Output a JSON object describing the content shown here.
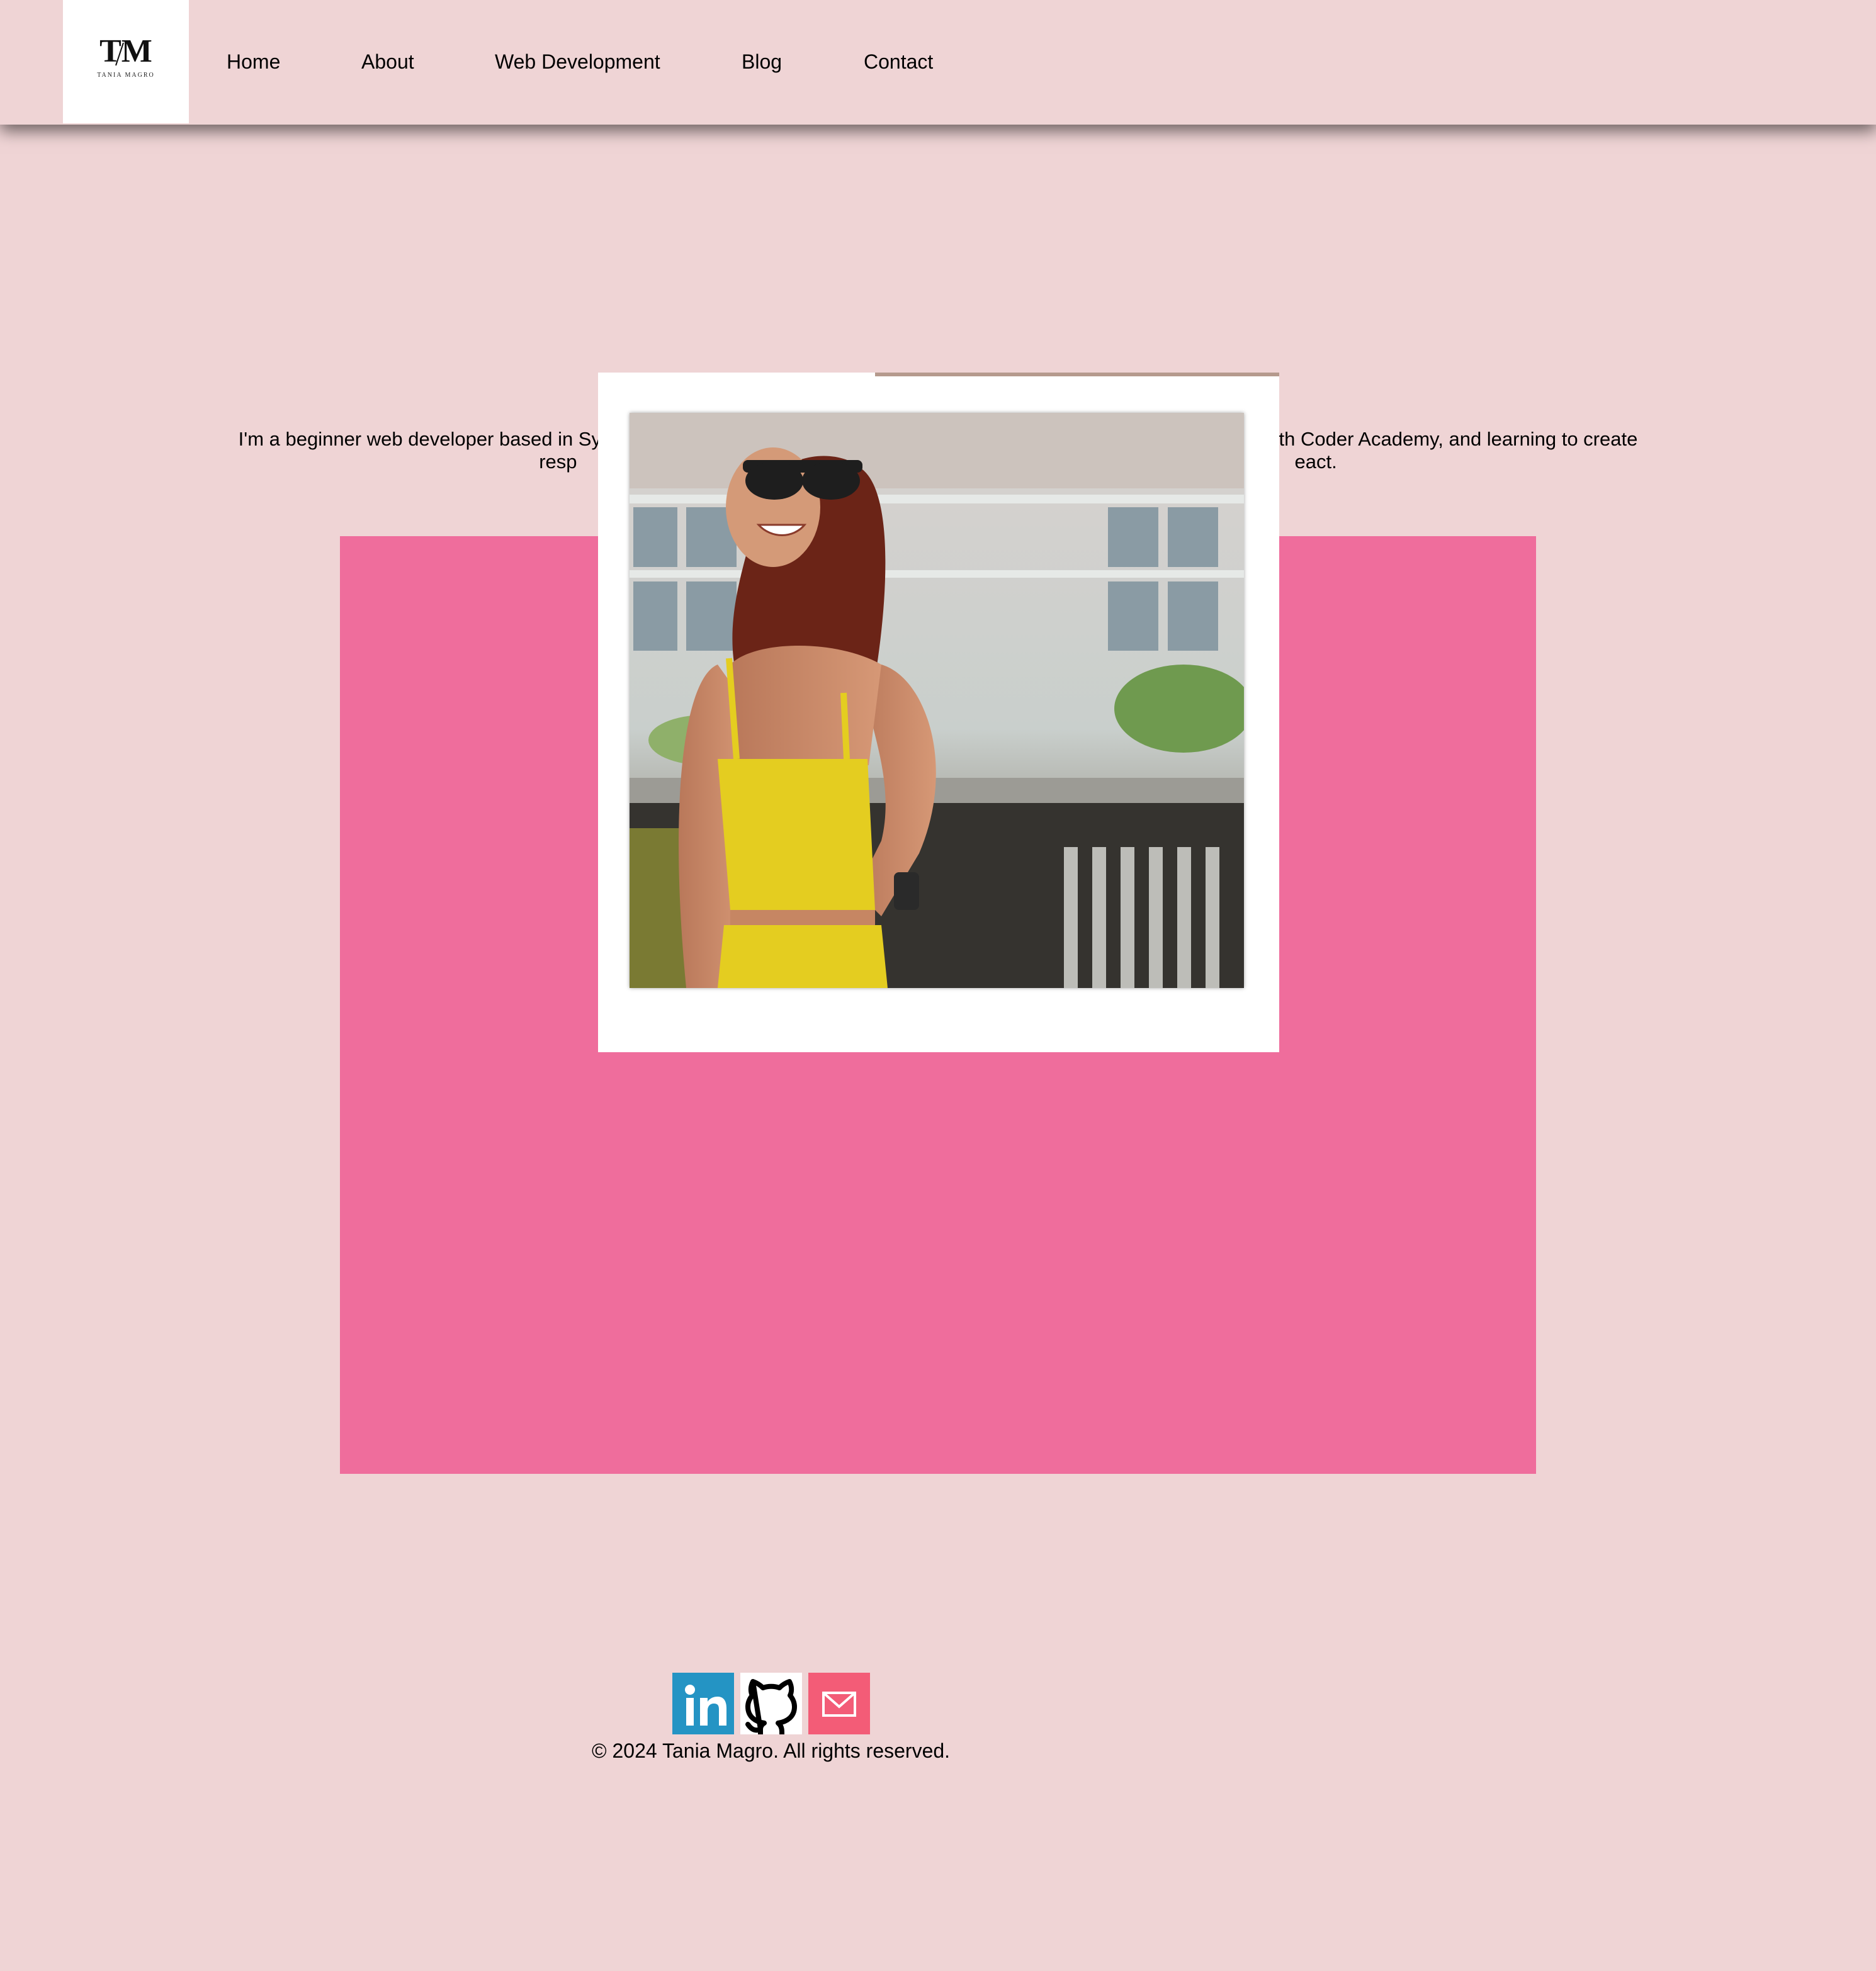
{
  "brand": {
    "monogram": "TM",
    "name": "TANIA MAGRO"
  },
  "nav": {
    "items": [
      {
        "label": "Home"
      },
      {
        "label": "About"
      },
      {
        "label": "Web Development"
      },
      {
        "label": "Blog"
      },
      {
        "label": "Contact"
      }
    ]
  },
  "intro": {
    "line1_left": "I'm a beginner web developer based in Syd",
    "line1_right": "with Coder Academy, and learning to create",
    "line2_left": "resp",
    "line2_right": "eact."
  },
  "profile_photo": {
    "icon": "portrait-photo",
    "alt": "Tania Magro"
  },
  "footer": {
    "social": [
      {
        "icon": "linkedin-icon",
        "label": "in",
        "color": "#2494c4"
      },
      {
        "icon": "github-icon",
        "label": "GitHub",
        "color": "#000000"
      },
      {
        "icon": "mail-icon",
        "label": "Email",
        "color": "#f35c77"
      }
    ],
    "copyright": "© 2024 Tania Magro. All rights reserved."
  },
  "colors": {
    "background": "#efd4d5",
    "accent_pink": "#ef6d9c",
    "polaroid_frame": "#ffffff"
  }
}
